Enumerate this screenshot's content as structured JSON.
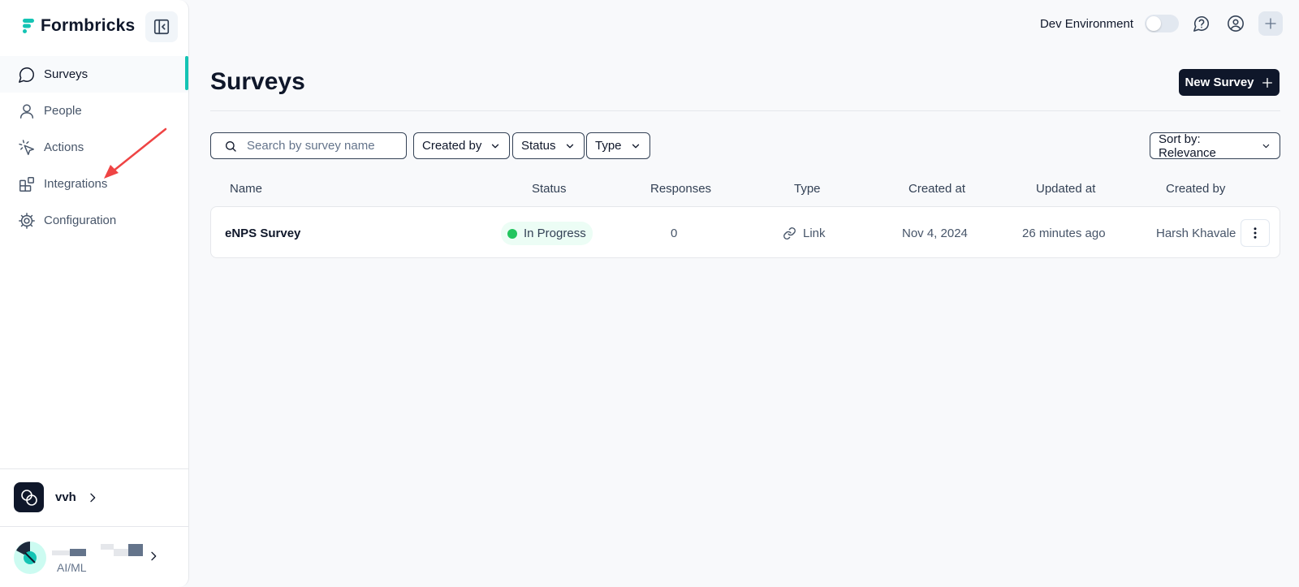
{
  "brand": {
    "name": "Formbricks"
  },
  "sidebar": {
    "items": [
      {
        "label": "Surveys",
        "icon": "message-circle-icon"
      },
      {
        "label": "People",
        "icon": "user-icon"
      },
      {
        "label": "Actions",
        "icon": "mouse-pointer-click-icon"
      },
      {
        "label": "Integrations",
        "icon": "blocks-icon"
      },
      {
        "label": "Configuration",
        "icon": "settings-icon"
      }
    ],
    "environment": {
      "name": "vvh"
    },
    "user": {
      "label": "AI/ML"
    }
  },
  "topbar": {
    "dev_label": "Dev Environment",
    "dev_enabled": false
  },
  "main": {
    "title": "Surveys",
    "new_survey_label": "New Survey",
    "search": {
      "placeholder": "Search by survey name",
      "value": ""
    },
    "filters": {
      "created_by": "Created by",
      "status": "Status",
      "type": "Type",
      "sort": "Sort by: Relevance"
    },
    "columns": {
      "name": "Name",
      "status": "Status",
      "responses": "Responses",
      "type": "Type",
      "created_at": "Created at",
      "updated_at": "Updated at",
      "created_by": "Created by"
    },
    "rows": [
      {
        "name": "eNPS Survey",
        "status": "In Progress",
        "responses": "0",
        "type": "Link",
        "created_at": "Nov 4, 2024",
        "updated_at": "26 minutes ago",
        "created_by": "Harsh Khavale"
      }
    ]
  },
  "colors": {
    "accent": "#14c4b4",
    "primary": "#0f172a",
    "status_in_progress": "#22c55e",
    "annotation_arrow": "#ef4444"
  }
}
